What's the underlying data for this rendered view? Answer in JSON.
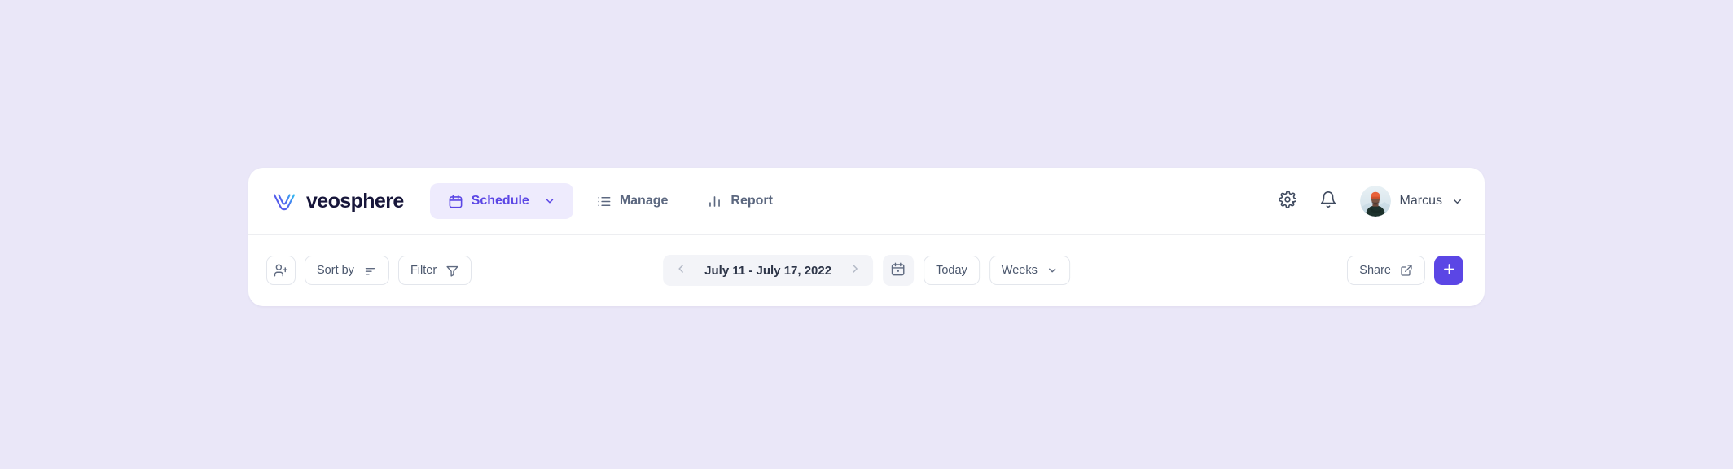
{
  "theme": {
    "page_background": "#eae7f8",
    "card_background": "#ffffff",
    "accent": "#5b46e5",
    "accent_soft": "#eeebfd",
    "text_primary": "#2d3548",
    "text_muted": "#5c6880",
    "border": "#e3e6ec",
    "pill_background": "#f3f4f8",
    "logo_gradient_from": "#5b46e5",
    "logo_gradient_to": "#2ec5f0"
  },
  "brand": {
    "name": "veosphere",
    "icon": "veosphere-v-mark"
  },
  "nav": {
    "items": [
      {
        "label": "Schedule",
        "icon": "calendar-icon",
        "active": true,
        "has_chevron": true
      },
      {
        "label": "Manage",
        "icon": "list-icon",
        "active": false,
        "has_chevron": false
      },
      {
        "label": "Report",
        "icon": "bar-chart-icon",
        "active": false,
        "has_chevron": false
      }
    ]
  },
  "header_actions": {
    "settings_icon": "gear-icon",
    "notifications_icon": "bell-icon",
    "user": {
      "name": "Marcus",
      "avatar_alt": "user-avatar-photo",
      "chevron": "chevron-down-icon"
    }
  },
  "toolbar": {
    "add_person_icon": "add-person-icon",
    "sort_by_label": "Sort by",
    "sort_by_icon": "sort-icon",
    "filter_label": "Filter",
    "filter_icon": "funnel-icon",
    "date_range": "July 11 - July 17, 2022",
    "prev_icon": "chevron-left-icon",
    "next_icon": "chevron-right-icon",
    "calendar_icon": "calendar-icon",
    "today_label": "Today",
    "view_label": "Weeks",
    "view_chevron": "chevron-down-icon",
    "share_label": "Share",
    "share_icon": "external-link-icon",
    "add_label": "+",
    "add_icon": "plus-icon"
  }
}
